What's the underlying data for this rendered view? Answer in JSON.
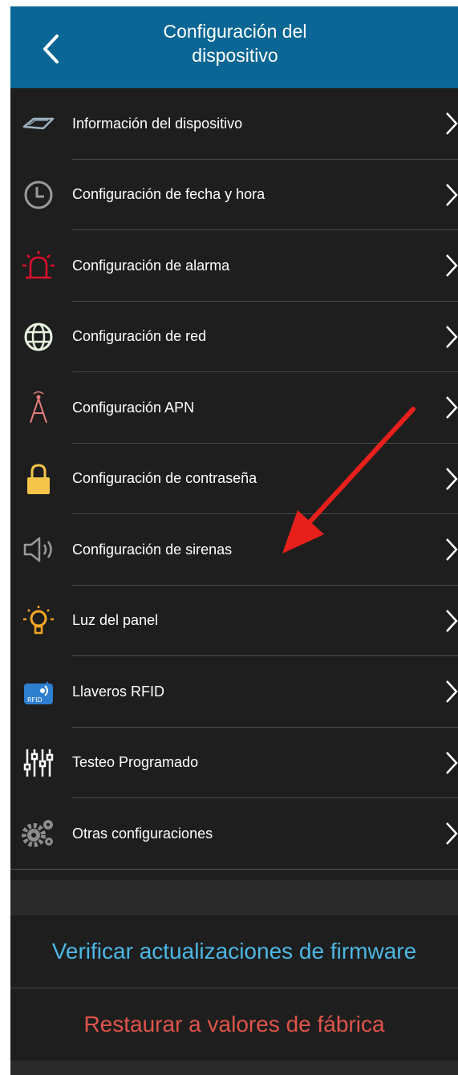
{
  "header": {
    "title_line1": "Configuración del",
    "title_line2": "dispositivo"
  },
  "menu": [
    {
      "label": "Información del dispositivo",
      "icon": "device-info-icon"
    },
    {
      "label": "Configuración de fecha y hora",
      "icon": "clock-icon"
    },
    {
      "label": "Configuración de alarma",
      "icon": "alarm-siren-icon"
    },
    {
      "label": "Configuración de red",
      "icon": "globe-icon"
    },
    {
      "label": "Configuración APN",
      "icon": "antenna-tower-icon"
    },
    {
      "label": "Configuración de contraseña",
      "icon": "padlock-icon"
    },
    {
      "label": "Configuración de sirenas",
      "icon": "speaker-icon"
    },
    {
      "label": "Luz del panel",
      "icon": "light-bulb-icon"
    },
    {
      "label": "Llaveros RFID",
      "icon": "rfid-tag-icon"
    },
    {
      "label": "Testeo Programado",
      "icon": "sliders-icon"
    },
    {
      "label": "Otras configuraciones",
      "icon": "gears-icon"
    }
  ],
  "actions": {
    "firmware": "Verificar actualizaciones de firmware",
    "factory_reset": "Restaurar a valores de fábrica"
  },
  "colors": {
    "header_bg": "#0a6694",
    "background": "#1e1e1e",
    "firmware_link": "#4cb7e5",
    "factory_link": "#e05449",
    "annotation_arrow": "#e8201c"
  }
}
